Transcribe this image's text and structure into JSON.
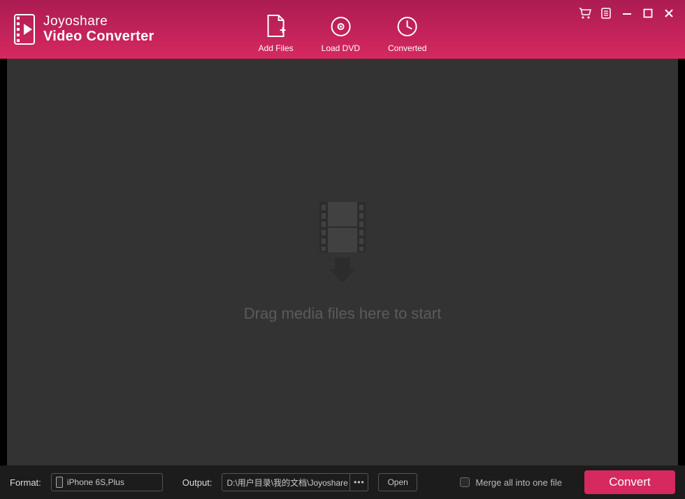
{
  "app": {
    "brand_line1": "Joyoshare",
    "brand_line2": "Video Converter"
  },
  "toolbar": {
    "add_files": "Add Files",
    "load_dvd": "Load DVD",
    "converted": "Converted"
  },
  "main": {
    "drop_message": "Drag media files here to start"
  },
  "footer": {
    "format_label": "Format:",
    "format_value": "iPhone 6S,Plus",
    "output_label": "Output:",
    "output_path": "D:\\用户目录\\我的文档\\Joyoshare V",
    "browse_dots": "•••",
    "open_label": "Open",
    "merge_label": "Merge all into one file",
    "convert_label": "Convert"
  },
  "colors": {
    "accent": "#d6295f",
    "header_bg": "#ab1c52",
    "main_bg": "#333333",
    "footer_bg": "#1c1c1c"
  }
}
